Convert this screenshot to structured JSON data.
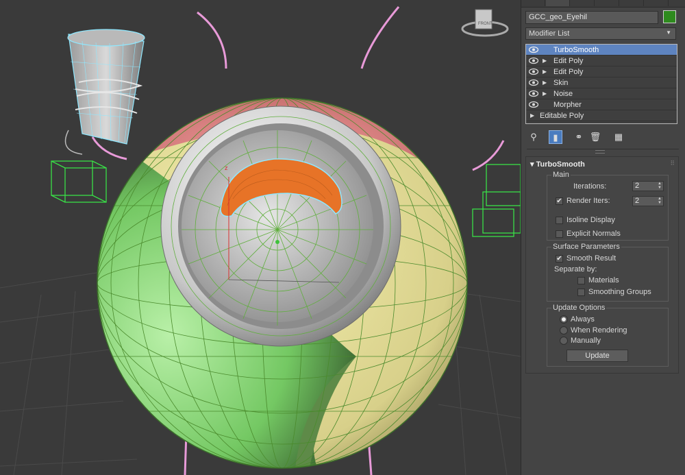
{
  "command_panel": {
    "object_name": "GCC_geo_Eyehil",
    "object_color": "#2e8a1e",
    "modifier_list_label": "Modifier List",
    "stack": [
      {
        "label": "TurboSmooth",
        "selected": true
      },
      {
        "label": "Edit Poly",
        "selected": false
      },
      {
        "label": "Edit Poly",
        "selected": false
      },
      {
        "label": "Skin",
        "selected": false
      },
      {
        "label": "Noise",
        "selected": false
      },
      {
        "label": "Morpher",
        "selected": false
      },
      {
        "label": "Editable Poly",
        "selected": false
      }
    ],
    "tool_icons": [
      "pin-stack-icon",
      "show-end-result-icon",
      "make-unique-icon",
      "remove-modifier-icon",
      "configure-modifier-sets-icon"
    ]
  },
  "turbosmooth": {
    "title": "TurboSmooth",
    "main": {
      "label": "Main",
      "iterations_label": "Iterations:",
      "iterations_value": "2",
      "render_iters_label": "Render Iters:",
      "render_iters_value": "2",
      "render_iters_checked": true,
      "isoline_display_label": "Isoline Display",
      "isoline_display_checked": false,
      "explicit_normals_label": "Explicit Normals",
      "explicit_normals_checked": false
    },
    "surface": {
      "label": "Surface Parameters",
      "smooth_result_label": "Smooth Result",
      "smooth_result_checked": true,
      "separate_by_label": "Separate by:",
      "materials_label": "Materials",
      "materials_checked": false,
      "smoothing_groups_label": "Smoothing Groups",
      "smoothing_groups_checked": false
    },
    "update": {
      "label": "Update Options",
      "always_label": "Always",
      "when_rendering_label": "When Rendering",
      "manually_label": "Manually",
      "selected": "Always",
      "update_button_label": "Update"
    }
  },
  "viewport": {
    "background": "#3a3a3a",
    "viewcube_face_label": "FRONT"
  }
}
